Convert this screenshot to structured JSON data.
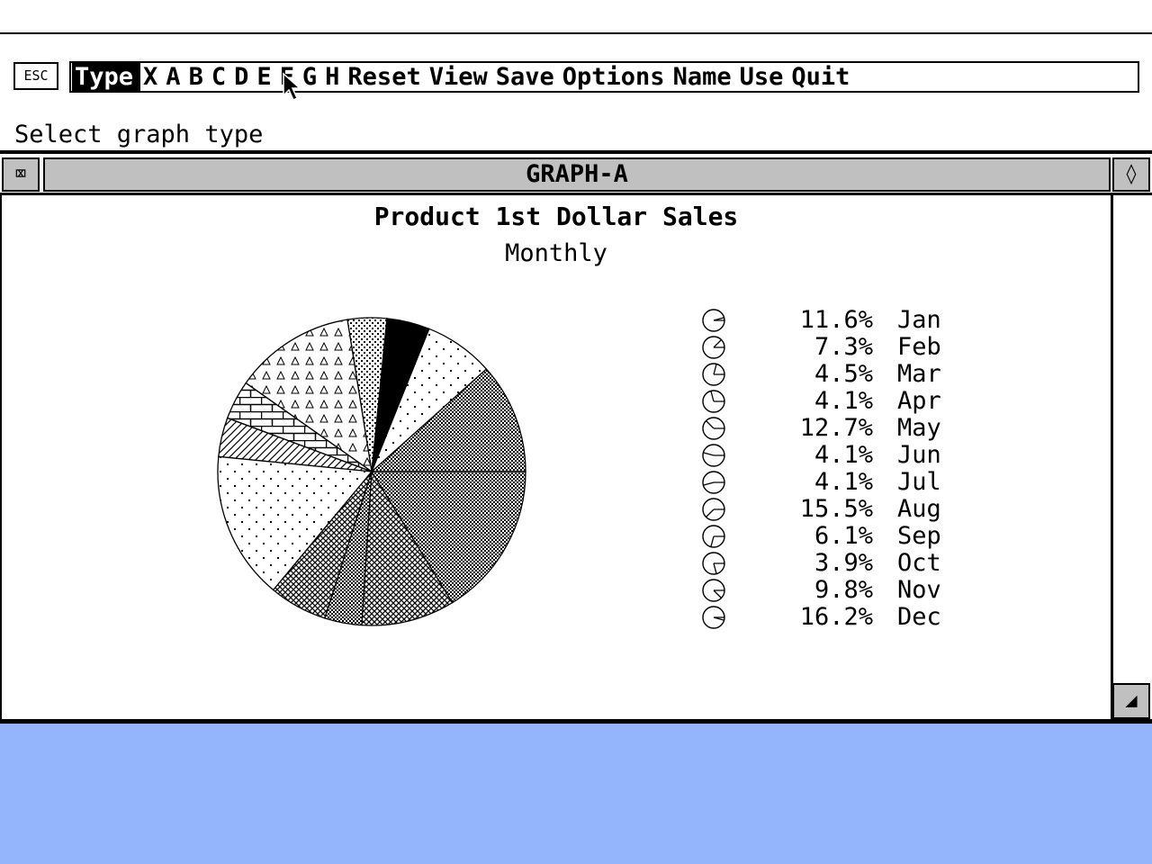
{
  "esc_label": "ESC",
  "menu": [
    "Type",
    "X",
    "A",
    "B",
    "C",
    "D",
    "E",
    "F",
    "G",
    "H",
    "Reset",
    "View",
    "Save",
    "Options",
    "Name",
    "Use",
    "Quit"
  ],
  "selected_menu_index": 0,
  "prompt": "Select graph type",
  "window": {
    "title": "GRAPH-A",
    "close_glyph": "⌧",
    "full_glyph": "◊",
    "size_glyph": "◢"
  },
  "colors": {
    "desktop": "#94b4fc",
    "chrome": "#c0c0c0",
    "ink": "#000000",
    "paper": "#ffffff"
  },
  "chart_data": {
    "type": "pie",
    "title": "Product 1st Dollar Sales",
    "subtitle": "Monthly",
    "categories": [
      "Jan",
      "Feb",
      "Mar",
      "Apr",
      "May",
      "Jun",
      "Jul",
      "Aug",
      "Sep",
      "Oct",
      "Nov",
      "Dec"
    ],
    "values": [
      11.6,
      7.3,
      4.5,
      4.1,
      12.7,
      4.1,
      4.1,
      15.5,
      6.1,
      3.9,
      9.8,
      16.2
    ],
    "labels": [
      "11.6%",
      "7.3%",
      "4.5%",
      "4.1%",
      "12.7%",
      "4.1%",
      "4.1%",
      "15.5%",
      "6.1%",
      "3.9%",
      "9.8%",
      "16.2%"
    ],
    "patterns": [
      "dots-dense",
      "dots-sparse",
      "solid-black",
      "dots-fine",
      "triangles",
      "bricks",
      "diagonal",
      "dots-sparse",
      "crosshatch",
      "checker",
      "crosshatch",
      "checker"
    ],
    "legend_position": "right"
  }
}
